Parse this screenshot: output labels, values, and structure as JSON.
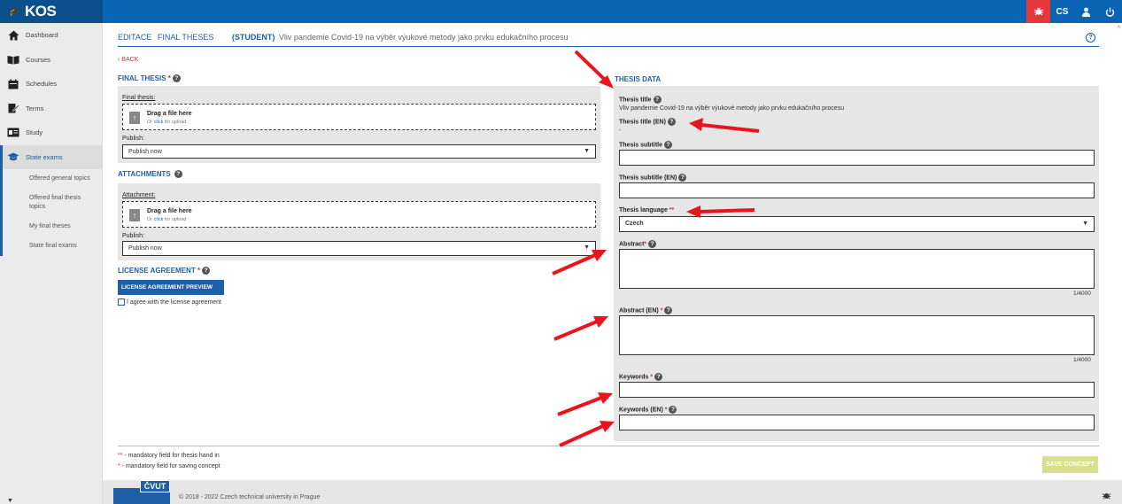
{
  "app": {
    "logo": "KOS",
    "lang": "CS"
  },
  "sidebar": {
    "items": [
      {
        "label": "Dashboard",
        "icon": "home-icon"
      },
      {
        "label": "Courses",
        "icon": "book-icon"
      },
      {
        "label": "Schedules",
        "icon": "calendar-icon"
      },
      {
        "label": "Terms",
        "icon": "edit-icon"
      },
      {
        "label": "Study",
        "icon": "id-card-icon"
      },
      {
        "label": "State exams",
        "icon": "graduation-cap-icon",
        "active": true
      }
    ],
    "subitems": [
      "Offered general topics",
      "Offered final thesis topics",
      "My final theses",
      "State final exams"
    ]
  },
  "header": {
    "editace": "EDITACE",
    "final_theses": "FINAL THESES",
    "student": "(STUDENT)",
    "thesis_name": "Vliv pandemie Covid-19 na výběr výukové metody jako prvku edukačního procesu"
  },
  "back": "BACK",
  "final_thesis": {
    "title": "FINAL THESIS",
    "req": "*",
    "field_label": "Final thesis:",
    "drop_title": "Drag a file here",
    "drop_or": "Or",
    "drop_click": "click",
    "drop_rest": "for upload",
    "publish_label": "Publish:",
    "publish_value": "Publish now"
  },
  "attachments": {
    "title": "ATTACHMENTS",
    "field_label": "Attachment:",
    "drop_title": "Drag a file here",
    "drop_or": "Or",
    "drop_click": "click",
    "drop_rest": "for upload",
    "publish_label": "Publish:",
    "publish_value": "Publish now"
  },
  "license": {
    "title": "LICENSE AGREEMENT",
    "req": "*",
    "preview_button": "LICENSE AGREEMENT PREVIEW",
    "agree_label": "I agree with the license agreement"
  },
  "thesis_data": {
    "title": "THESIS DATA",
    "thesis_title_label": "Thesis title",
    "thesis_title_value": "Vliv pandemie Covid-19 na výběr výukové metody jako prvku edukačního procesu",
    "thesis_title_en_label": "Thesis title (EN)",
    "thesis_title_en_value": "-",
    "subtitle_label": "Thesis subtitle",
    "subtitle_en_label": "Thesis subtitle (EN)",
    "language_label": "Thesis language",
    "language_req": "**",
    "language_value": "Czech",
    "abstract_label": "Abstract",
    "abstract_counter": "1/4000",
    "abstract_en_label": "Abstract (EN)",
    "abstract_en_counter": "1/4000",
    "keywords_label": "Keywords",
    "keywords_en_label": "Keywords (EN)",
    "req": "*"
  },
  "footnotes": {
    "double_star": "**",
    "double_text": " - mandatory field for thesis hand in",
    "single_star": "*",
    "single_text": " - mandatory field for saving concept"
  },
  "save_button": "SAVE CONCEPT",
  "footer": {
    "brand": "ČVUT",
    "copyright": "© 2018 - 2022 Czech technical university in Prague"
  },
  "colors": {
    "primary": "#1e5fa8",
    "topbar": "#0a64b4",
    "alert": "#e23a3a",
    "annotation": "#e8141e"
  }
}
